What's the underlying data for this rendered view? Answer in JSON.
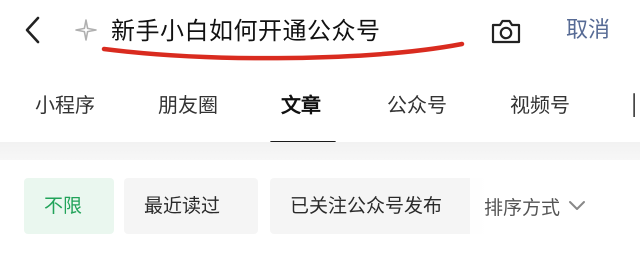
{
  "header": {
    "query": "新手小白如何开通公众号",
    "cancel_label": "取消",
    "annotation_color": "#d92b1f"
  },
  "tabs": [
    {
      "label": "小程序",
      "active": false
    },
    {
      "label": "朋友圈",
      "active": false
    },
    {
      "label": "文章",
      "active": true
    },
    {
      "label": "公众号",
      "active": false
    },
    {
      "label": "视频号",
      "active": false
    }
  ],
  "filters": {
    "chips": [
      {
        "label": "不限",
        "active": true
      },
      {
        "label": "最近读过",
        "active": false
      },
      {
        "label": "已关注公众号发布",
        "active": false
      }
    ],
    "sort_label": "排序方式"
  },
  "icons": {
    "back": "back-arrow-icon",
    "sparkle": "sparkle-icon",
    "camera": "camera-icon",
    "sort": "chevron-down-icon"
  },
  "colors": {
    "link": "#576b95",
    "active_chip_text": "#22a35a",
    "active_chip_bg": "#eaf7ef"
  }
}
